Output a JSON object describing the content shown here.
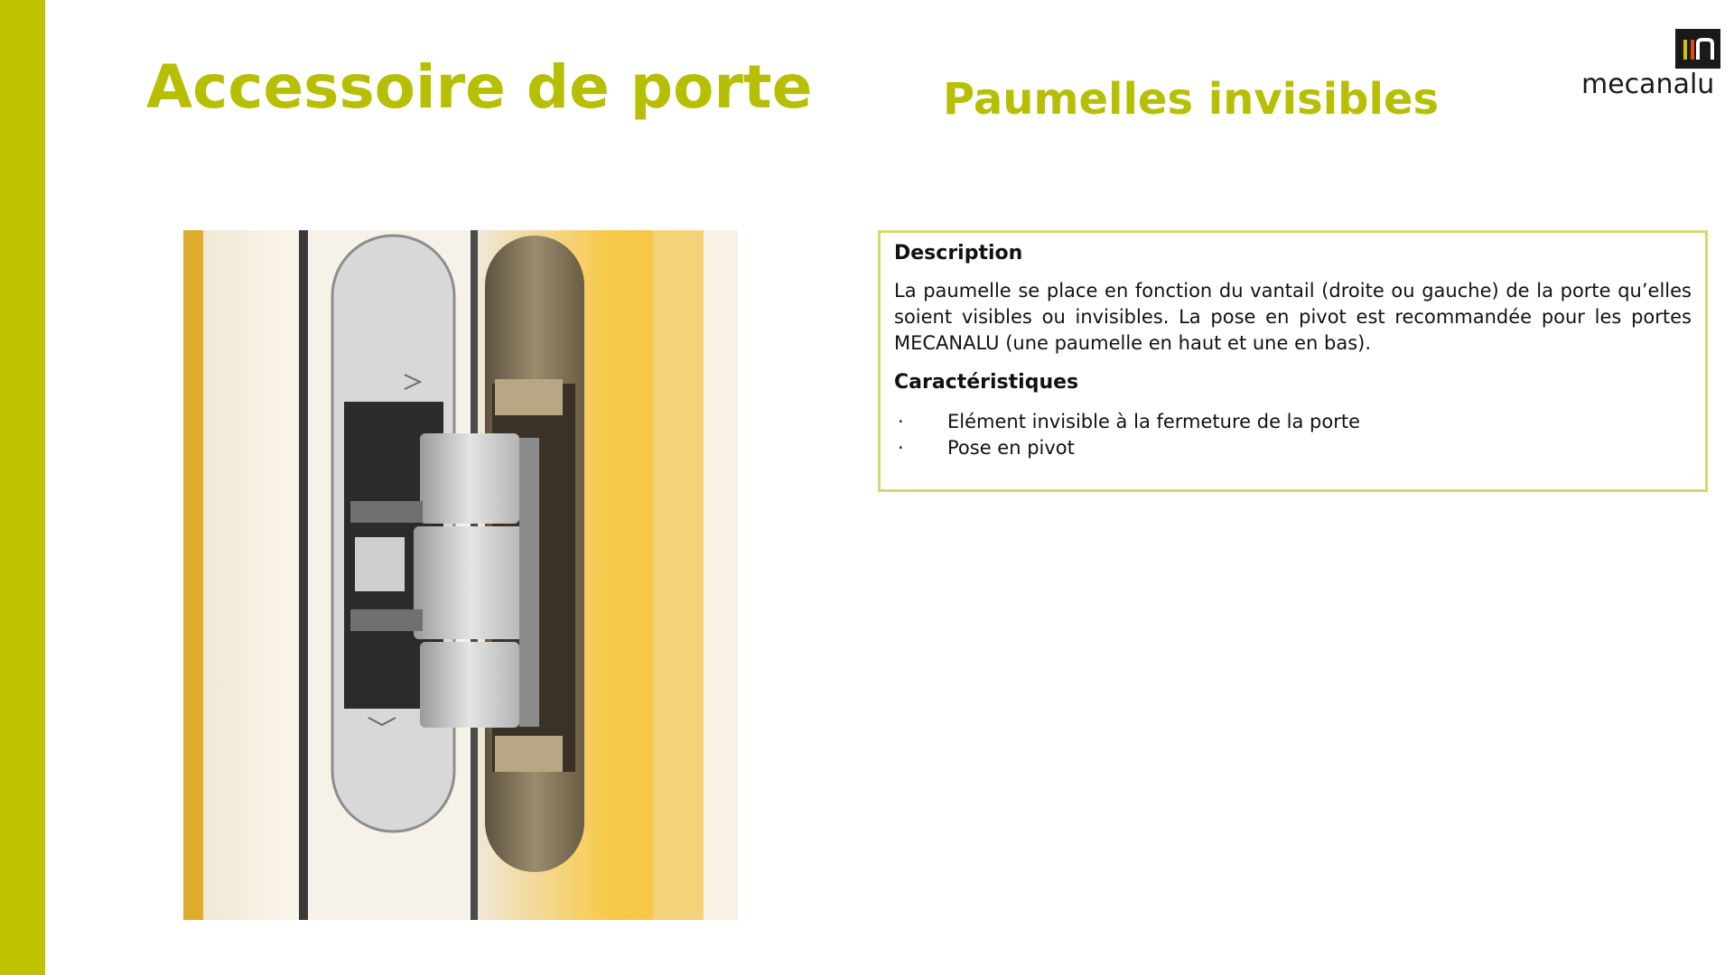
{
  "header": {
    "title": "Accessoire de porte",
    "subtitle": "Paumelles invisibles"
  },
  "logo": {
    "text": "mecanalu",
    "mark": "m"
  },
  "photo": {
    "subject": "invisible-hinge-photo"
  },
  "info": {
    "description_heading": "Description",
    "description_text": "La paumelle se place en fonction du vantail (droite ou gauche) de la porte qu’elles soient visibles ou invisibles. La pose en pivot est recommandée pour les portes MECANALU (une paumelle en haut et une en bas).",
    "features_heading": "Caractéristiques",
    "bullet_char": "·",
    "features": [
      "Elément invisible à la fermeture de la porte",
      "Pose en pivot"
    ]
  },
  "colors": {
    "accent": "#b7bf05",
    "sidebar": "#bfc200",
    "box_border": "#d5d86d"
  }
}
